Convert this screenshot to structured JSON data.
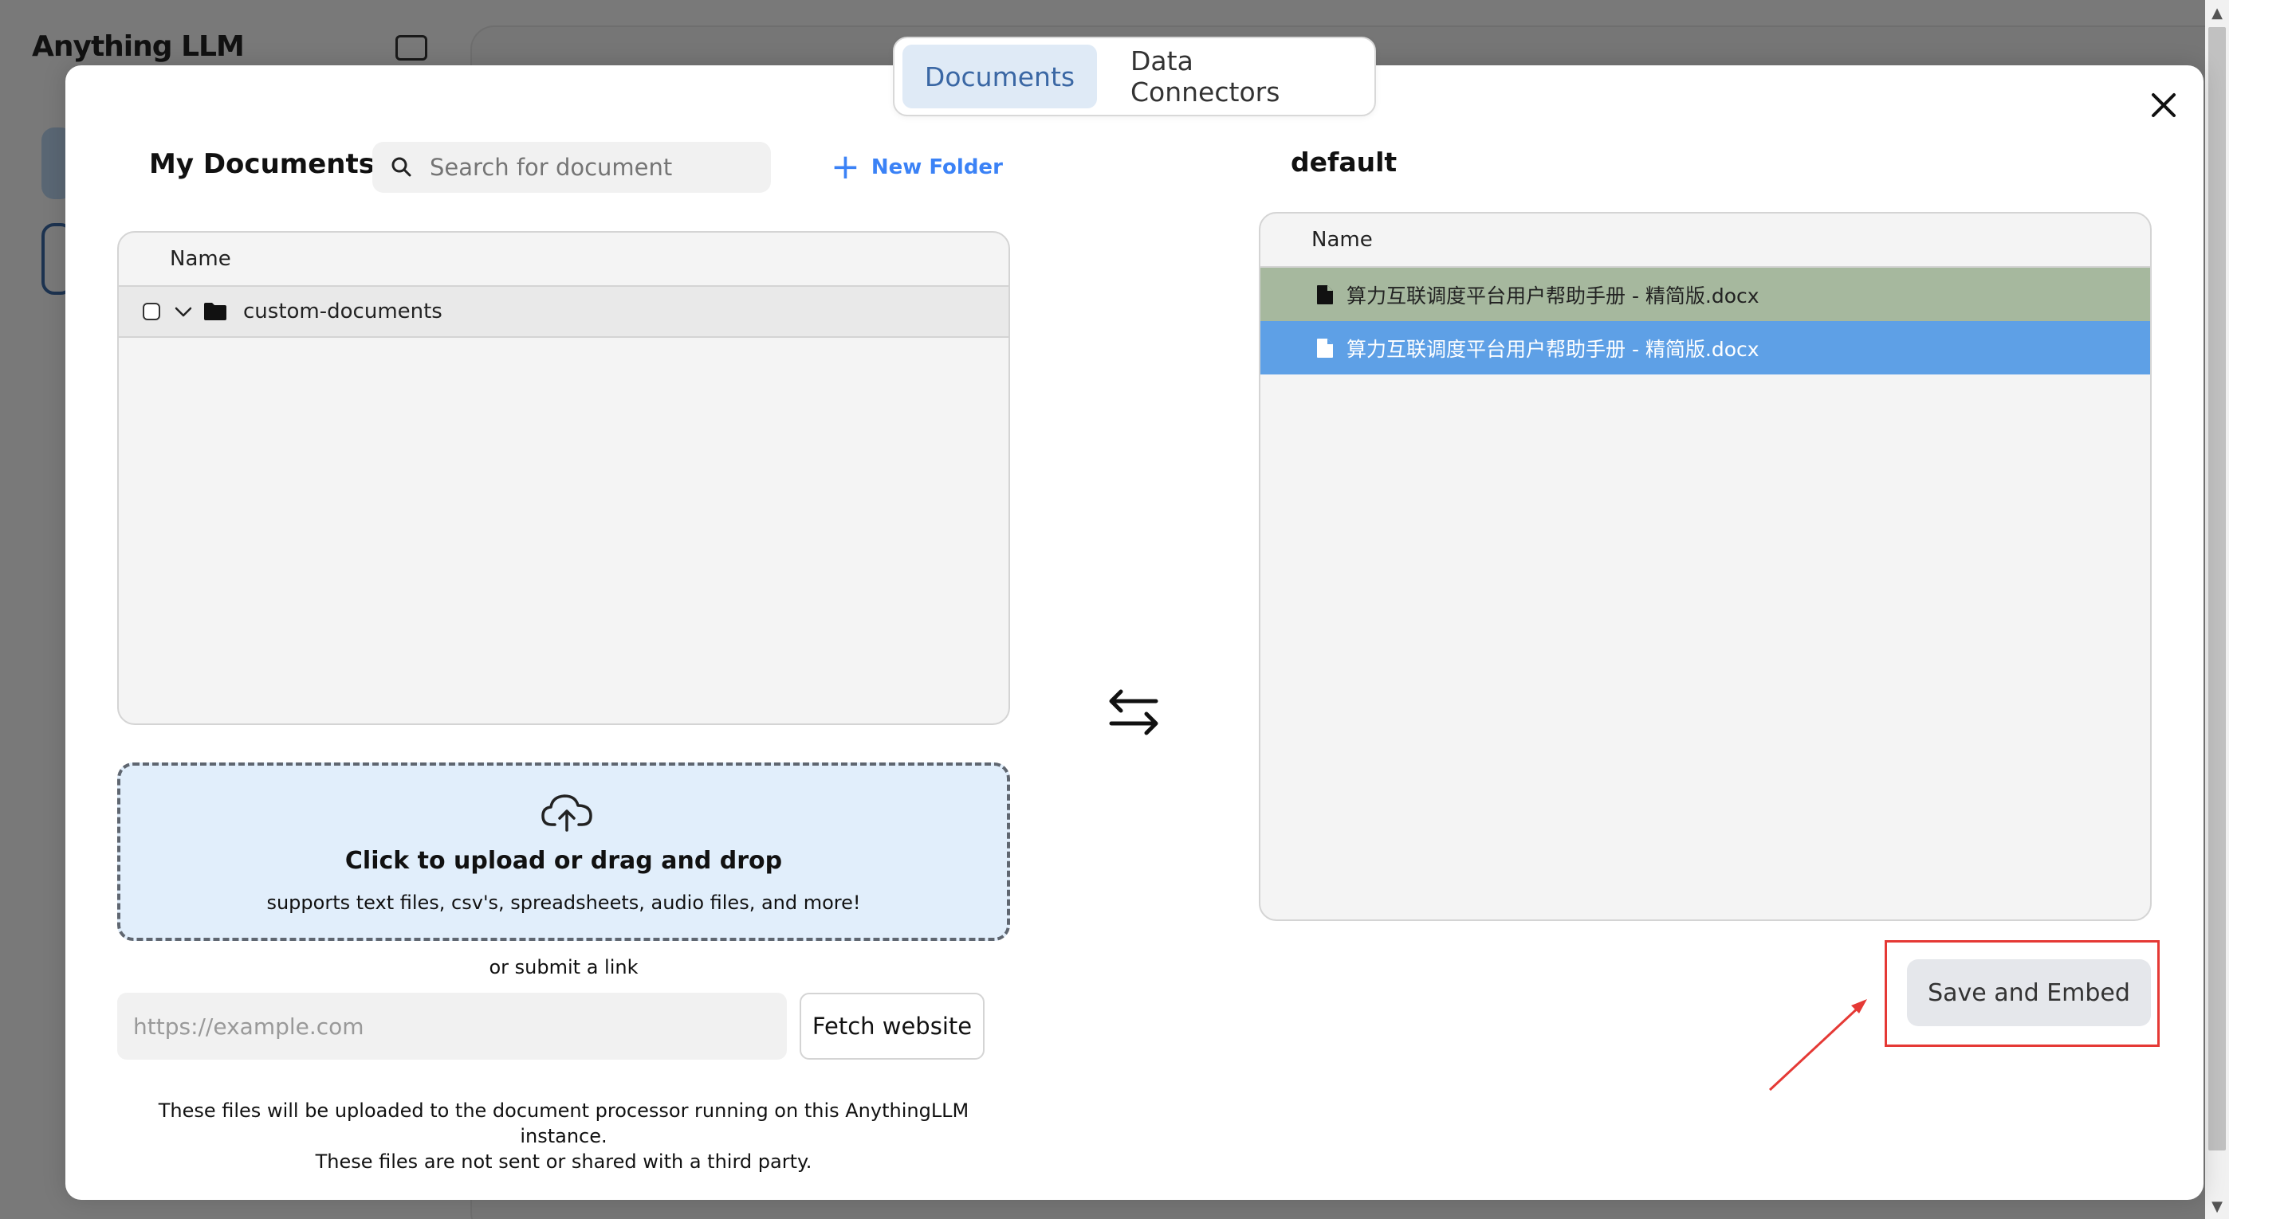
{
  "background": {
    "app_logo": "Anything LLM"
  },
  "tabs": [
    {
      "label": "Documents",
      "active": true
    },
    {
      "label": "Data Connectors",
      "active": false
    }
  ],
  "left_panel": {
    "title": "My Documents",
    "search_placeholder": "Search for document",
    "new_folder_label": "New Folder",
    "table_header": "Name",
    "rows": [
      {
        "name": "custom-documents",
        "type": "folder",
        "expanded": true,
        "checked": false
      }
    ]
  },
  "upload": {
    "title": "Click to upload or drag and drop",
    "subtitle": "supports text files, csv's, spreadsheets, audio files, and more!"
  },
  "link_submit": {
    "or_text": "or submit a link",
    "input_placeholder": "https://example.com",
    "button_label": "Fetch website"
  },
  "footer_note": {
    "line1": "These files will be uploaded to the document processor running on this AnythingLLM instance.",
    "line2": "These files are not sent or shared with a third party."
  },
  "right_panel": {
    "workspace_title": "default",
    "table_header": "Name",
    "rows": [
      {
        "name": "算力互联调度平台用户帮助手册 - 精简版.docx",
        "state": "embedded"
      },
      {
        "name": "算力互联调度平台用户帮助手册 - 精简版.docx",
        "state": "pending"
      }
    ]
  },
  "actions": {
    "save_label": "Save and Embed"
  },
  "colors": {
    "tab_active_bg": "#dfeaf6",
    "tab_active_text": "#3a67a4",
    "accent_blue": "#3b82f6",
    "row_embedded_bg": "#a6b89e",
    "row_pending_bg": "#5ea0e6",
    "upload_bg": "#e1eefb",
    "annotation_red": "#e53935"
  },
  "icons": {
    "close": "close-icon",
    "search": "search-icon",
    "plus": "plus-icon",
    "chevron": "chevron-down-icon",
    "folder": "folder-icon",
    "upload": "cloud-upload-icon",
    "swap": "swap-arrows-icon",
    "file": "file-icon"
  }
}
